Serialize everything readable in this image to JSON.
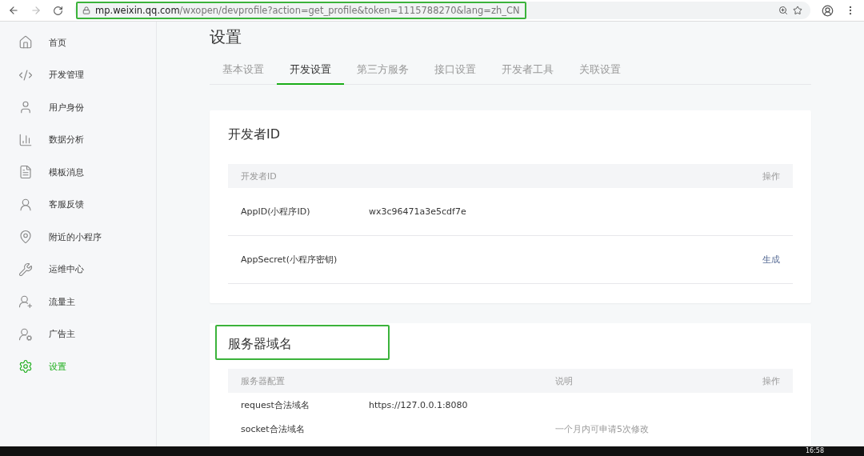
{
  "browser": {
    "url_host": "mp.weixin.qq.com",
    "url_path": "/wxopen/devprofile?action=get_profile&token=1115788270&lang=zh_CN",
    "url_highlighted": true
  },
  "sidebar": {
    "items": [
      {
        "label": "首页",
        "selected": false
      },
      {
        "label": "开发管理",
        "selected": false
      },
      {
        "label": "用户身份",
        "selected": false
      },
      {
        "label": "数据分析",
        "selected": false
      },
      {
        "label": "模板消息",
        "selected": false
      },
      {
        "label": "客服反馈",
        "selected": false
      },
      {
        "label": "附近的小程序",
        "selected": false
      },
      {
        "label": "运维中心",
        "selected": false
      },
      {
        "label": "流量主",
        "selected": false
      },
      {
        "label": "广告主",
        "selected": false
      },
      {
        "label": "设置",
        "selected": true
      }
    ]
  },
  "page_title": "设置",
  "tabs": [
    {
      "label": "基本设置",
      "selected": false
    },
    {
      "label": "开发设置",
      "selected": true
    },
    {
      "label": "第三方服务",
      "selected": false
    },
    {
      "label": "接口设置",
      "selected": false
    },
    {
      "label": "开发者工具",
      "selected": false
    },
    {
      "label": "关联设置",
      "selected": false
    }
  ],
  "developer_card": {
    "title": "开发者ID",
    "columns": [
      "开发者ID",
      "操作"
    ],
    "rows": [
      {
        "name": "AppID(小程序ID)",
        "value": "wx3c96471a3e5cdf7e"
      },
      {
        "name": "AppSecret(小程序密钥)",
        "action": "生成"
      }
    ]
  },
  "server_card": {
    "title": "服务器域名",
    "title_highlighted": true,
    "columns": [
      "服务器配置",
      "说明",
      "操作"
    ],
    "rows": [
      {
        "name": "request合法域名",
        "value": "https://127.0.0.1:8080"
      },
      {
        "name": "socket合法域名",
        "note": "一个月内可申请5次修改"
      }
    ]
  },
  "taskbar": {
    "time": "16:58"
  }
}
